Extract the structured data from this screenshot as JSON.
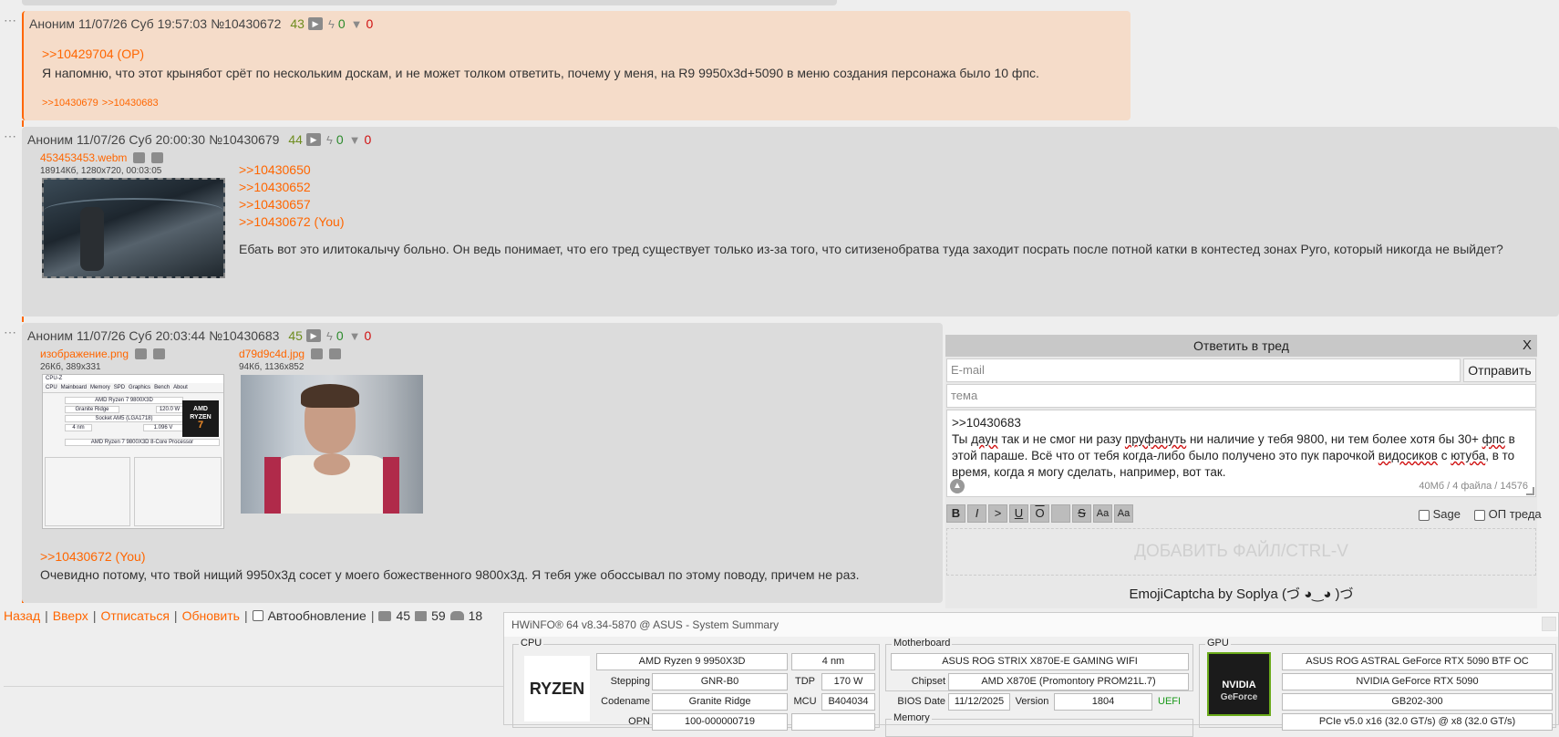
{
  "posts": [
    {
      "author": "Аноним",
      "datetime": "11/07/26 Суб 19:57:03",
      "num": "№10430672",
      "index": "43",
      "likes": "0",
      "dislikes": "0",
      "quote": ">>10429704 (OP)",
      "text": "Я напомню, что этот крынябот срёт по нескольким доскам, и не может толком ответить, почему у меня, на R9 9950x3d+5090 в меню создания персонажа было 10 фпс.",
      "replies": [
        ">>10430679",
        ">>10430683"
      ]
    },
    {
      "author": "Аноним",
      "datetime": "11/07/26 Суб 20:00:30",
      "num": "№10430679",
      "index": "44",
      "likes": "0",
      "dislikes": "0",
      "file_name": "453453453.webm",
      "file_info": "18914Кб, 1280x720, 00:03:05",
      "quotes": [
        ">>10430650",
        ">>10430652",
        ">>10430657",
        ">>10430672 (You)"
      ],
      "text": "Ебать вот это илитокалычу больно. Он ведь понимает, что его тред существует только из-за того, что ситизенобратва туда заходит посрать после потной катки в контестед зонах Pyro, который никогда не выйдет?"
    },
    {
      "author": "Аноним",
      "datetime": "11/07/26 Суб 20:03:44",
      "num": "№10430683",
      "index": "45",
      "likes": "0",
      "dislikes": "0",
      "files": [
        {
          "name": "изображение.png",
          "info": "26Кб, 389x331"
        },
        {
          "name": "d79d9c4d.jpg",
          "info": "94Кб, 1136x852"
        }
      ],
      "quote": ">>10430672 (You)",
      "text": "Очевидно потому, что твой нищий 9950x3д сосет у моего божественного 9800x3д. Я тебя уже обоссывал по этому поводу, причем не раз."
    }
  ],
  "cpuz": {
    "title": "CPU-Z",
    "tabs": [
      "CPU",
      "Mainboard",
      "Memory",
      "SPD",
      "Graphics",
      "Bench",
      "About"
    ],
    "name": "AMD Ryzen 7 9800X3D",
    "codename": "Granite Ridge",
    "tdp": "120.0 W",
    "package": "Socket AM5 (LGA1718)",
    "tech": "4 nm",
    "vcore": "1.096 V",
    "spec": "AMD Ryzen 7 9800X3D 8-Core Processor",
    "logo_line1": "AMD",
    "logo_line2": "RYZEN",
    "logo_line3": "7"
  },
  "reply_form": {
    "title": "Ответить в тред",
    "close": "X",
    "email_placeholder": "E-mail",
    "send": "Отправить",
    "subject_placeholder": "тема",
    "message_line1": ">>10430683",
    "msg_a": "Ты ",
    "msg_b": "даун",
    "msg_c": " так и не смог ни разу ",
    "msg_d": "пруфануть",
    "msg_e": " ни наличие у тебя 9800, ни тем более хотя бы 30+ ",
    "msg_f": "фпс",
    "msg_g": " в этой параше. Всё что от тебя когда-либо было получено это пук парочкой ",
    "msg_h": "видосиков",
    "msg_i": " с ",
    "msg_j": "ютуба",
    "msg_k": ", в то время, когда я могу сделать, например, вот так.",
    "limits": "40Мб / 4 файла / 14576",
    "fmt": [
      "B",
      "I",
      ">",
      "U",
      "O",
      "",
      "S",
      "Aa",
      "Aa"
    ],
    "sage": "Sage",
    "op": "ОП треда",
    "drop": "ДОБАВИТЬ ФАЙЛ/CTRL-V",
    "captcha": "EmojiCaptcha by Soplya (づ ◕‿◕ )づ"
  },
  "nav": {
    "back": "Назад",
    "up": "Вверх",
    "unsub": "Отписаться",
    "refresh": "Обновить",
    "autorefresh": "Автообновление",
    "posts": "45",
    "images": "59",
    "users": "18"
  },
  "hwinfo": {
    "title": "HWiNFO® 64 v8.34-5870 @ ASUS  - System Summary",
    "cpu_group": "CPU",
    "cpu_name": "AMD Ryzen 9 9950X3D",
    "cpu_node": "4 nm",
    "stepping_label": "Stepping",
    "stepping": "GNR-B0",
    "tdp_label": "TDP",
    "tdp": "170 W",
    "codename_label": "Codename",
    "codename": "Granite Ridge",
    "mcu_label": "MCU",
    "mcu": "B404034",
    "opn_label": "OPN",
    "opn": "100-000000719",
    "ryzen_logo": "RYZEN",
    "mb_group": "Motherboard",
    "mb_name": "ASUS ROG STRIX X870E-E GAMING WIFI",
    "chipset_label": "Chipset",
    "chipset": "AMD X870E (Promontory PROM21L.7)",
    "bios_label": "BIOS Date",
    "bios": "11/12/2025",
    "version_label": "Version",
    "version": "1804",
    "uefi": "UEFI",
    "mem_group": "Memory",
    "gpu_group": "GPU",
    "gpu_name": "ASUS ROG ASTRAL GeForce RTX 5090 BTF OC",
    "gpu_model": "NVIDIA GeForce RTX 5090",
    "gpu_chip": "GB202-300",
    "gpu_pcie": "PCIe v5.0 x16 (32.0 GT/s) @ x8 (32.0 GT/s)",
    "nvidia_logo1": "NVIDIA",
    "nvidia_logo2": "GeForce"
  }
}
